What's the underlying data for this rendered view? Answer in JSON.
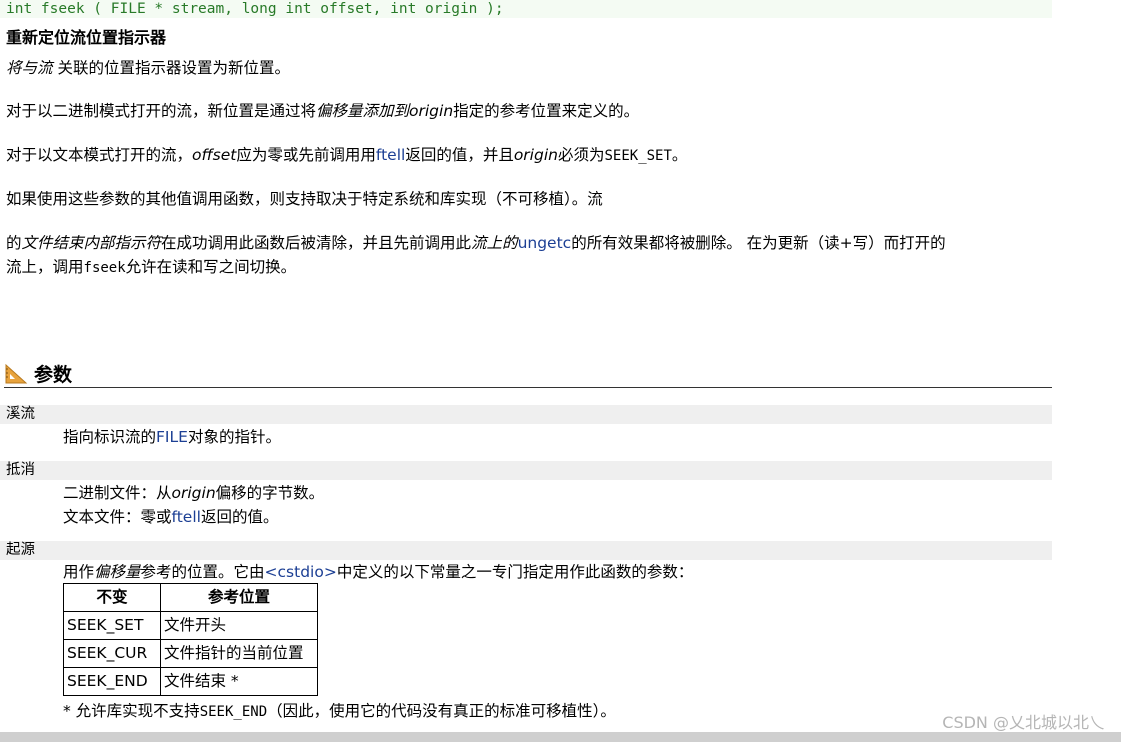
{
  "prototype": "int fseek ( FILE * stream, long int offset, int origin );",
  "heading": "重新定位流位置指示器",
  "p1": {
    "italic": "将与流",
    "rest": " 关联的位置指示器设置为新位置。"
  },
  "p2": {
    "a": "对于以二进制模式打开的流，新位置是通过将",
    "italic": "偏移量添加到origin",
    "b": "指定的参考位置来定义的。"
  },
  "p3": {
    "a": "对于以文本模式打开的流，",
    "italic1": "offset",
    "b": "应为零或先前调用用",
    "link": "ftell",
    "c": "返回的值，并且",
    "italic2": "origin",
    "d": "必须为",
    "mono": "SEEK_SET",
    "e": "。"
  },
  "p4": "如果使用这些参数的其他值调用函数，则支持取决于特定系统和库实现（不可移植）。流",
  "p5": {
    "a": "的",
    "italic1": "文件结束内部指示符",
    "b": "在成功调用此函数后被清除，并且先前调用此",
    "italic2": "流上的",
    "link": "ungetc",
    "c": "的所有效果都将被删除。 在为更新（读+写）而打开的",
    "line2a": "流上，调用",
    "mono": "fseek",
    "line2b": "允许在读和写之间切换。"
  },
  "section_title": "参数",
  "params": [
    {
      "name": "溪流",
      "desc_a": "指向标识流的",
      "desc_link": "FILE",
      "desc_b": "对象的指针。"
    },
    {
      "name": "抵消",
      "line1_a": "二进制文件：从",
      "line1_italic": "origin",
      "line1_b": "偏移的字节数。",
      "line2_a": "文本文件：零或",
      "line2_link": "ftell",
      "line2_b": "返回的值。"
    },
    {
      "name": "起源",
      "desc_a": "用作",
      "desc_italic": "偏移量",
      "desc_b": "参考的位置。它由",
      "desc_link": "<cstdio>",
      "desc_c": "中定义的以下常量之一专门指定用作此函数的参数："
    }
  ],
  "table": {
    "headers": [
      "不变",
      "参考位置"
    ],
    "rows": [
      [
        "SEEK_SET",
        "文件开头"
      ],
      [
        "SEEK_CUR",
        "文件指针的当前位置"
      ],
      [
        "SEEK_END",
        "文件结束 *"
      ]
    ]
  },
  "footnote": {
    "a": "* 允许库实现不支持",
    "mono": "SEEK_END",
    "b": "（因此，使用它的代码没有真正的标准可移植性）。"
  },
  "watermark": "CSDN @乂北城以北乀",
  "colors": {
    "prototype_text": "#287a28",
    "prototype_bg": "#f4fbf3",
    "link": "#1c3f94",
    "param_bar": "#efefef",
    "icon": "#e8a33d"
  }
}
